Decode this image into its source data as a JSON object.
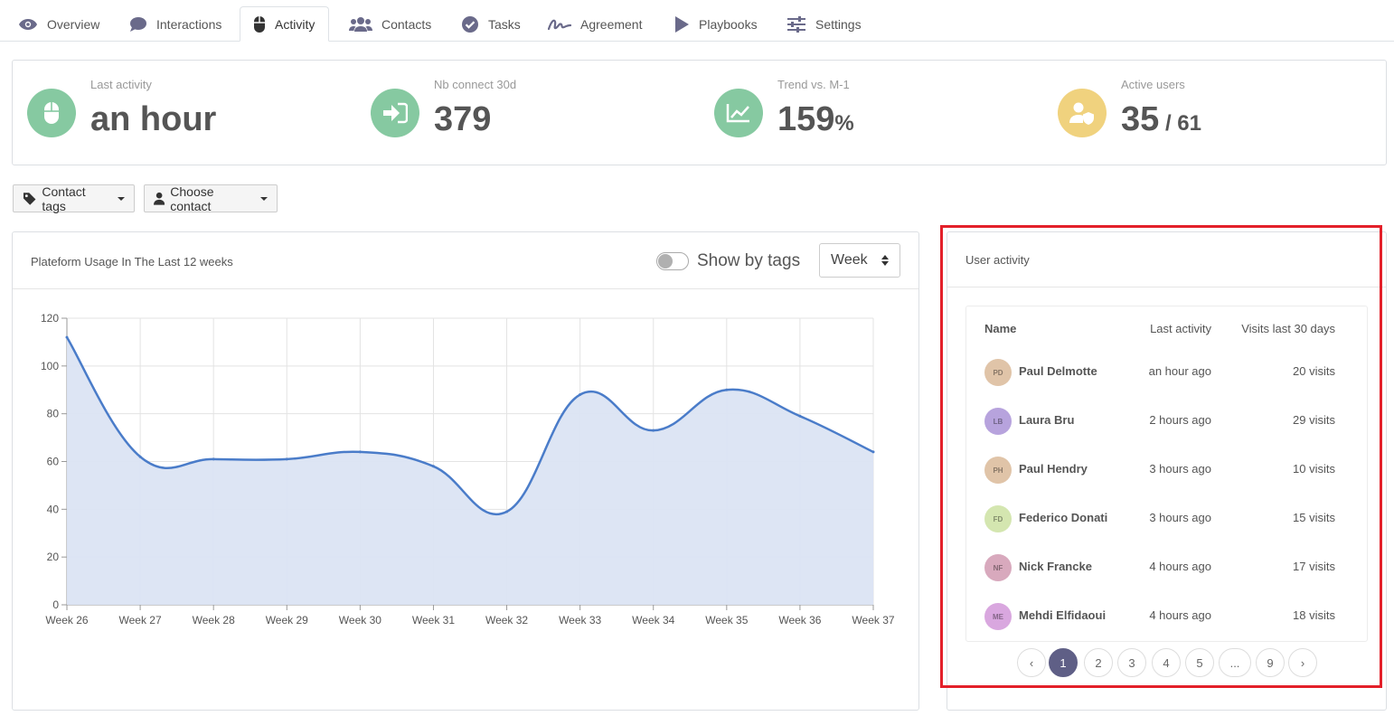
{
  "tabs": [
    {
      "label": "Overview"
    },
    {
      "label": "Interactions"
    },
    {
      "label": "Activity"
    },
    {
      "label": "Contacts"
    },
    {
      "label": "Tasks"
    },
    {
      "label": "Agreement"
    },
    {
      "label": "Playbooks"
    },
    {
      "label": "Settings"
    }
  ],
  "kpis": {
    "last_activity": {
      "label": "Last activity",
      "value": "an hour"
    },
    "connect": {
      "label": "Nb connect 30d",
      "value": "379"
    },
    "trend": {
      "label": "Trend vs. M-1",
      "value": "159",
      "unit": "%"
    },
    "active_users": {
      "label": "Active users",
      "value": "35",
      "total": " / 61"
    }
  },
  "filters": {
    "contact_tags": "Contact tags",
    "choose_contact": "Choose contact"
  },
  "usage_panel": {
    "title": "Plateform Usage In The Last 12 weeks",
    "toggle_label": "Show by tags",
    "period": "Week"
  },
  "chart_data": {
    "type": "area",
    "categories": [
      "Week 26",
      "Week 27",
      "Week 28",
      "Week 29",
      "Week 30",
      "Week 31",
      "Week 32",
      "Week 33",
      "Week 34",
      "Week 35",
      "Week 36",
      "Week 37"
    ],
    "values": [
      112,
      62,
      61,
      61,
      64,
      58,
      39,
      88,
      73,
      90,
      79,
      64
    ],
    "ylim": [
      0,
      120
    ],
    "yticks": [
      0,
      20,
      40,
      60,
      80,
      100,
      120
    ],
    "grid": true,
    "colors": {
      "line": "#4a7cc9",
      "fill": "#dbe4f3"
    }
  },
  "user_activity": {
    "title": "User activity",
    "columns": {
      "name": "Name",
      "last": "Last activity",
      "visits": "Visits last 30 days"
    },
    "rows": [
      {
        "initials": "PD",
        "name": "Paul Delmotte",
        "last": "an hour ago",
        "visits": "20 visits",
        "color": "#e0c4a8"
      },
      {
        "initials": "LB",
        "name": "Laura Bru",
        "last": "2 hours ago",
        "visits": "29 visits",
        "color": "#b7a3dd"
      },
      {
        "initials": "PH",
        "name": "Paul Hendry",
        "last": "3 hours ago",
        "visits": "10 visits",
        "color": "#e0c4a8"
      },
      {
        "initials": "FD",
        "name": "Federico Donati",
        "last": "3 hours ago",
        "visits": "15 visits",
        "color": "#d4e6b0"
      },
      {
        "initials": "NF",
        "name": "Nick Francke",
        "last": "4 hours ago",
        "visits": "17 visits",
        "color": "#d8a9bd"
      },
      {
        "initials": "ME",
        "name": "Mehdi Elfidaoui",
        "last": "4 hours ago",
        "visits": "18 visits",
        "color": "#d9a7df"
      }
    ],
    "pagination": [
      "‹",
      "1",
      "2",
      "3",
      "4",
      "5",
      "...",
      "9",
      "›"
    ],
    "current_page": "1"
  },
  "colors": {
    "kpi_green": "#86c9a1",
    "kpi_yellow": "#f0d27e",
    "pager_active": "#5f5f86",
    "highlight": "#e3202a"
  }
}
